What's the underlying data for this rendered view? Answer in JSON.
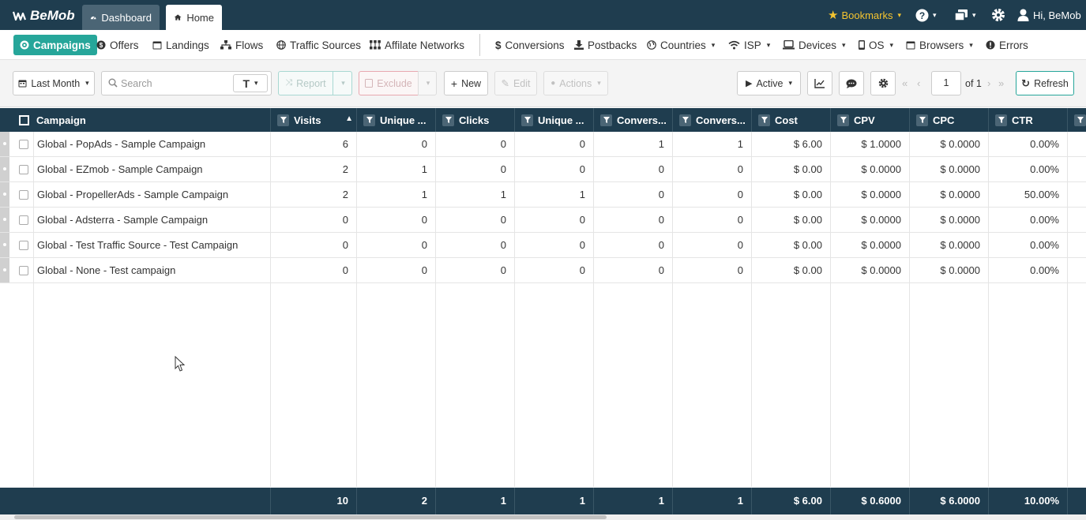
{
  "topbar": {
    "logo": "BeMob",
    "tabs": [
      {
        "label": "Dashboard"
      },
      {
        "label": "Home"
      }
    ],
    "bookmarks": "Bookmarks",
    "user": "Hi, BeMob"
  },
  "nav": {
    "items": [
      {
        "label": "Campaigns",
        "icon": "campaigns-icon",
        "active": true
      },
      {
        "label": "Offers",
        "icon": "offers-icon"
      },
      {
        "label": "Landings",
        "icon": "landings-icon"
      },
      {
        "label": "Flows",
        "icon": "flows-icon"
      },
      {
        "label": "Traffic Sources",
        "icon": "globe-icon"
      },
      {
        "label": "Affilate Networks",
        "icon": "networks-icon"
      },
      {
        "label": "Conversions",
        "icon": "dollar-icon"
      },
      {
        "label": "Postbacks",
        "icon": "download-icon"
      },
      {
        "label": "Countries",
        "icon": "globe-icon"
      },
      {
        "label": "ISP",
        "icon": "wifi-icon"
      },
      {
        "label": "Devices",
        "icon": "laptop-icon"
      },
      {
        "label": "OS",
        "icon": "mobile-icon"
      },
      {
        "label": "Browsers",
        "icon": "browser-icon"
      },
      {
        "label": "Errors",
        "icon": "error-icon"
      }
    ]
  },
  "toolbar": {
    "date_range": "Last Month",
    "search_placeholder": "Search",
    "report": "Report",
    "exclude": "Exclude",
    "new": "New",
    "edit": "Edit",
    "actions": "Actions",
    "status_filter": "Active",
    "page": "1",
    "page_of": "of 1",
    "refresh": "Refresh"
  },
  "grid": {
    "columns": [
      "Campaign",
      "Visits",
      "Unique ...",
      "Clicks",
      "Unique ...",
      "Convers...",
      "Convers...",
      "Cost",
      "CPV",
      "CPC",
      "CTR"
    ],
    "rows": [
      {
        "name": "Global - PopAds - Sample Campaign",
        "values": [
          "6",
          "0",
          "0",
          "0",
          "1",
          "1",
          "$ 6.00",
          "$ 1.0000",
          "$ 0.0000",
          "0.00%"
        ]
      },
      {
        "name": "Global - EZmob - Sample Campaign",
        "values": [
          "2",
          "1",
          "0",
          "0",
          "0",
          "0",
          "$ 0.00",
          "$ 0.0000",
          "$ 0.0000",
          "0.00%"
        ]
      },
      {
        "name": "Global - PropellerAds - Sample Campaign",
        "values": [
          "2",
          "1",
          "1",
          "1",
          "0",
          "0",
          "$ 0.00",
          "$ 0.0000",
          "$ 0.0000",
          "50.00%"
        ]
      },
      {
        "name": "Global - Adsterra - Sample Campaign",
        "values": [
          "0",
          "0",
          "0",
          "0",
          "0",
          "0",
          "$ 0.00",
          "$ 0.0000",
          "$ 0.0000",
          "0.00%"
        ]
      },
      {
        "name": "Global - Test Traffic Source - Test Campaign",
        "values": [
          "0",
          "0",
          "0",
          "0",
          "0",
          "0",
          "$ 0.00",
          "$ 0.0000",
          "$ 0.0000",
          "0.00%"
        ]
      },
      {
        "name": "Global - None - Test campaign",
        "values": [
          "0",
          "0",
          "0",
          "0",
          "0",
          "0",
          "$ 0.00",
          "$ 0.0000",
          "$ 0.0000",
          "0.00%"
        ]
      }
    ],
    "totals": [
      "10",
      "2",
      "1",
      "1",
      "1",
      "1",
      "$ 6.00",
      "$ 0.6000",
      "$ 6.0000",
      "10.00%"
    ]
  }
}
